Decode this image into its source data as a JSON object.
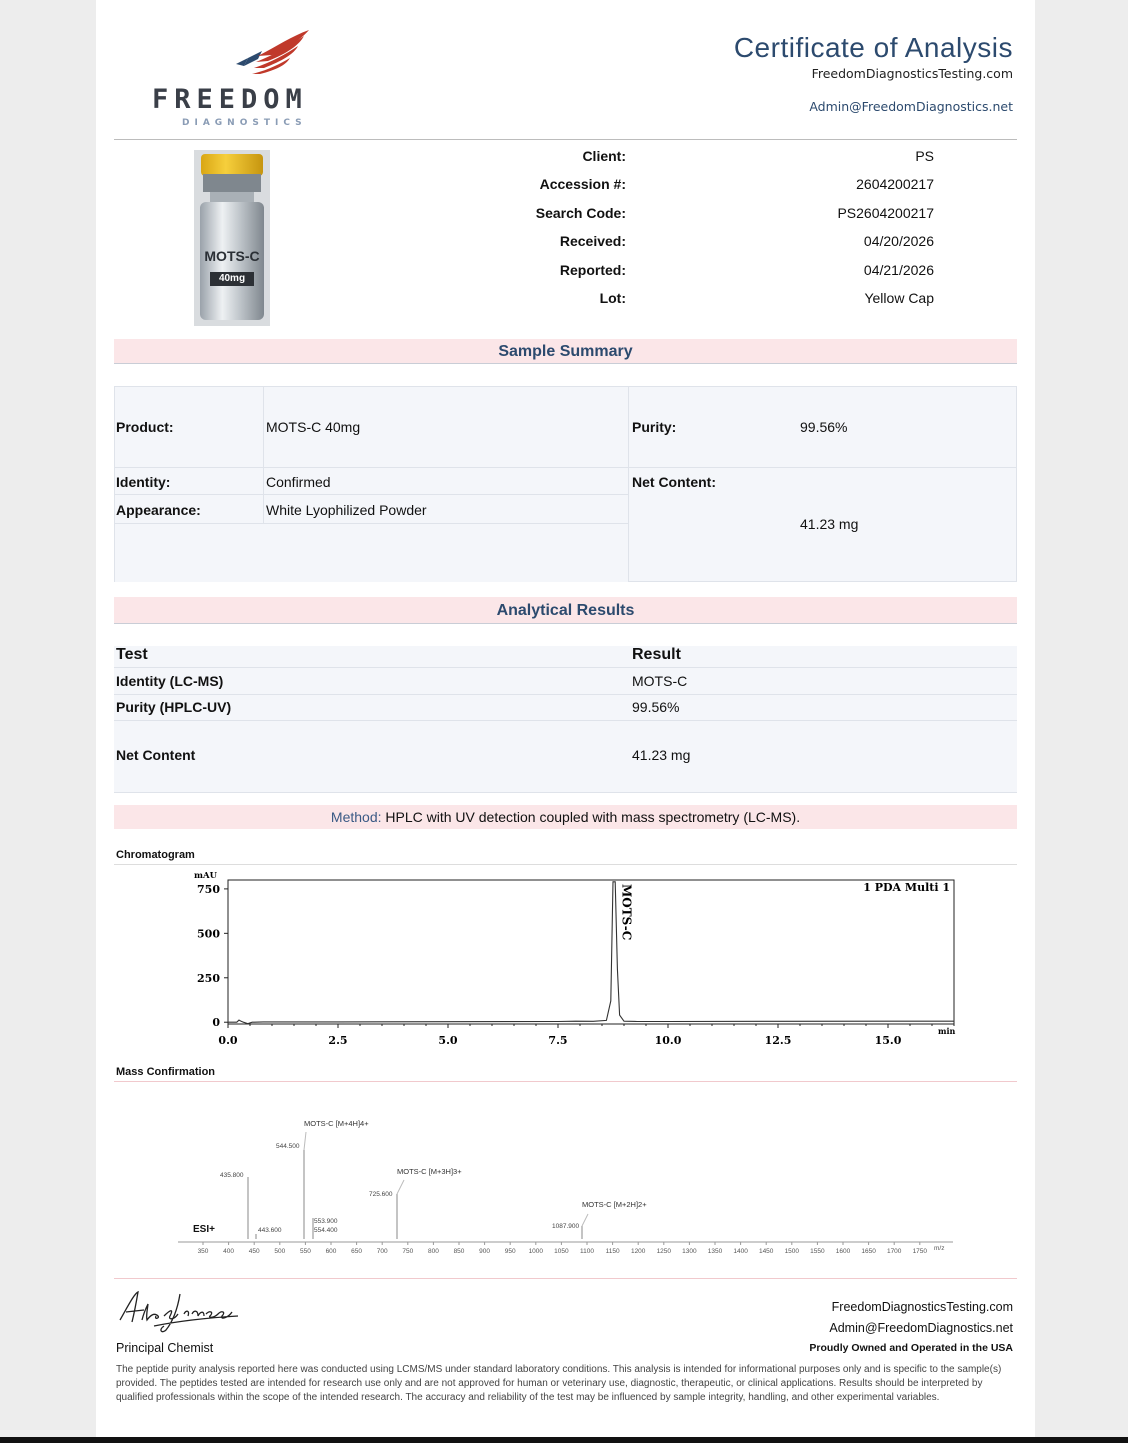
{
  "header": {
    "brand": "FREEDOM",
    "brand_sub": "DIAGNOSTICS",
    "title": "Certificate of Analysis",
    "website": "FreedomDiagnosticsTesting.com",
    "email": "Admin@FreedomDiagnostics.net"
  },
  "vial": {
    "name": "MOTS-C",
    "dose": "40mg"
  },
  "client_info": [
    {
      "label": "Client:",
      "value": "PS"
    },
    {
      "label": "Accession #:",
      "value": "2604200217"
    },
    {
      "label": "Search Code:",
      "value": "PS2604200217"
    },
    {
      "label": "Received:",
      "value": "04/20/2026"
    },
    {
      "label": "Reported:",
      "value": "04/21/2026"
    },
    {
      "label": "Lot:",
      "value": "Yellow Cap"
    }
  ],
  "sample_summary": {
    "title": "Sample Summary",
    "product_label": "Product:",
    "product": "MOTS-C 40mg",
    "identity_label": "Identity:",
    "identity": "Confirmed",
    "appearance_label": "Appearance:",
    "appearance": "White Lyophilized Powder",
    "purity_label": "Purity:",
    "purity": "99.56%",
    "net_label": "Net Content:",
    "net": "41.23 mg"
  },
  "analytical": {
    "title": "Analytical Results",
    "col_test": "Test",
    "col_result": "Result",
    "rows": [
      {
        "test": "Identity (LC-MS)",
        "result": "MOTS-C"
      },
      {
        "test": "Purity (HPLC-UV)",
        "result": "99.56%"
      },
      {
        "test": "Net Content",
        "result": "41.23 mg"
      }
    ]
  },
  "method": {
    "label": "Method:",
    "text": "HPLC with UV detection coupled with mass spectrometry (LC-MS)."
  },
  "chromatogram": {
    "caption": "Chromatogram",
    "y_unit": "mAU",
    "x_unit": "min",
    "legend": "1 PDA Multi 1",
    "peak_label": "MOTS-C",
    "y_ticks": [
      "750",
      "500",
      "250",
      "0"
    ],
    "x_ticks": [
      "0.0",
      "2.5",
      "5.0",
      "7.5",
      "10.0",
      "12.5",
      "15.0"
    ]
  },
  "mass": {
    "caption": "Mass Confirmation",
    "mode": "ESI+",
    "x_unit": "m/z",
    "x_ticks": [
      "350",
      "400",
      "450",
      "500",
      "550",
      "600",
      "650",
      "700",
      "750",
      "800",
      "850",
      "900",
      "950",
      "1000",
      "1050",
      "1100",
      "1150",
      "1200",
      "1250",
      "1300",
      "1350",
      "1400",
      "1450",
      "1500",
      "1550",
      "1600",
      "1650",
      "1700",
      "1750"
    ],
    "annotations": {
      "ion4": "MOTS-C [M+4H]4+",
      "ion3": "MOTS-C [M+3H]3+",
      "ion2": "MOTS-C [M+2H]2+"
    },
    "peak_labels": {
      "p1": "435.800",
      "p2": "443.600",
      "p3": "544.500",
      "p4a": "553.900",
      "p4b": "554.400",
      "p5": "725.600",
      "p6": "1087.900"
    }
  },
  "chart_data": {
    "type": "line",
    "title": "",
    "xlabel": "min",
    "ylabel": "mAU",
    "xlim": [
      0,
      16.5
    ],
    "ylim": [
      -10,
      800
    ],
    "series": [
      {
        "name": "1 PDA Multi 1",
        "x": [
          0,
          0.2,
          0.25,
          0.3,
          0.35,
          0.45,
          0.55,
          0.6,
          0.8,
          2.5,
          5.0,
          7.5,
          7.9,
          8.3,
          8.6,
          8.7,
          8.75,
          8.8,
          8.85,
          8.9,
          9.0,
          9.3,
          10.0,
          12.5,
          15.0,
          16.5
        ],
        "y": [
          0,
          0,
          12,
          5,
          0,
          -8,
          0,
          0,
          2,
          2,
          3,
          4,
          6,
          5,
          10,
          120,
          790,
          790,
          300,
          40,
          6,
          4,
          4,
          5,
          6,
          6
        ]
      }
    ]
  },
  "footer": {
    "signature": "Alex Johnson",
    "role": "Principal Chemist",
    "website": "FreedomDiagnosticsTesting.com",
    "email": "Admin@FreedomDiagnostics.net",
    "tagline": "Proudly Owned and Operated in the USA",
    "disclaimer": "The peptide purity analysis reported here was conducted using LCMS/MS under standard laboratory conditions. This analysis is intended for informational purposes only and is specific to the sample(s) provided. The peptides tested are intended for research use only and are not approved for human or veterinary use, diagnostic, therapeutic, or clinical applications. Results should be interpreted by qualified professionals within the scope of the intended research. The accuracy and reliability of the test may be influenced by sample integrity, handling, and other experimental variables."
  },
  "colors": {
    "accent": "#2c4a6e",
    "section_bar": "#fbe6e8",
    "table_bg": "#f4f6fa",
    "vial_cap": "#f2c230"
  }
}
